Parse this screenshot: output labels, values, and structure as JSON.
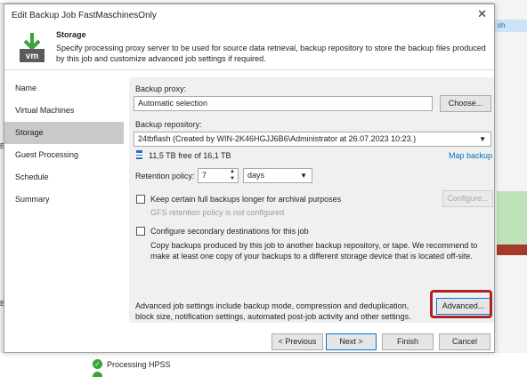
{
  "background": {
    "right_tab_text": "sh",
    "left_glyph_1": "B",
    "left_glyph_2": "B",
    "processing_item": "Processing HPSS"
  },
  "dialog": {
    "title": "Edit Backup Job FastMaschinesOnly",
    "header": {
      "title": "Storage",
      "description": "Specify processing proxy server to be used for source data retrieval, backup repository to store the backup files produced by this job and customize advanced job settings if required.",
      "icon_text": "vm"
    },
    "nav": {
      "items": [
        {
          "label": "Name"
        },
        {
          "label": "Virtual Machines"
        },
        {
          "label": "Storage"
        },
        {
          "label": "Guest Processing"
        },
        {
          "label": "Schedule"
        },
        {
          "label": "Summary"
        }
      ]
    },
    "storage": {
      "proxy_label": "Backup proxy:",
      "proxy_value": "Automatic selection",
      "choose_label": "Choose...",
      "repo_label": "Backup repository:",
      "repo_value": "24tbflash (Created by WIN-2K46HGJJ6B6\\Administrator at 26.07.2023 10:23.)",
      "free_space": "11,5 TB free of 16,1 TB",
      "map_backup": "Map backup",
      "retention_label": "Retention policy:",
      "retention_value": "7",
      "retention_unit": "days",
      "keep_full_label": "Keep certain full backups longer for archival purposes",
      "configure_label": "Configure...",
      "gfs_note": "GFS retention policy is not configured",
      "secondary_label": "Configure secondary destinations for this job",
      "secondary_desc": "Copy backups produced by this job to another backup repository, or tape. We recommend to make at least one copy of your backups to a different storage device that is located off-site.",
      "advanced_desc": "Advanced job settings include backup mode, compression and deduplication, block size, notification settings, automated post-job activity and other settings.",
      "advanced_label": "Advanced..."
    },
    "footer": {
      "previous": "< Previous",
      "next": "Next >",
      "finish": "Finish",
      "cancel": "Cancel"
    }
  },
  "colors": {
    "accent": "#0a6db8",
    "highlight": "#b02222",
    "content_bg": "#eef0f2"
  }
}
